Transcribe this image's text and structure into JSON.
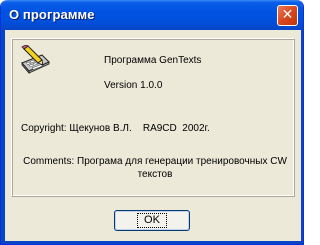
{
  "window": {
    "title": "О программе",
    "close_symbol": "✕"
  },
  "icon": {
    "name": "keyboard-pencil-icon"
  },
  "about": {
    "product": "Программа GenTexts",
    "version": "Version 1.0.0",
    "copyright": "Copyright: Щекунов В.Л.    RA9CD  2002г.",
    "comments": "Comments: Програма для генерации тренировочных CW текстов"
  },
  "buttons": {
    "ok": "OK"
  },
  "colors": {
    "titlebar": "#0052e0",
    "dialog_bg": "#ece9d8",
    "close_button": "#d9481f"
  }
}
